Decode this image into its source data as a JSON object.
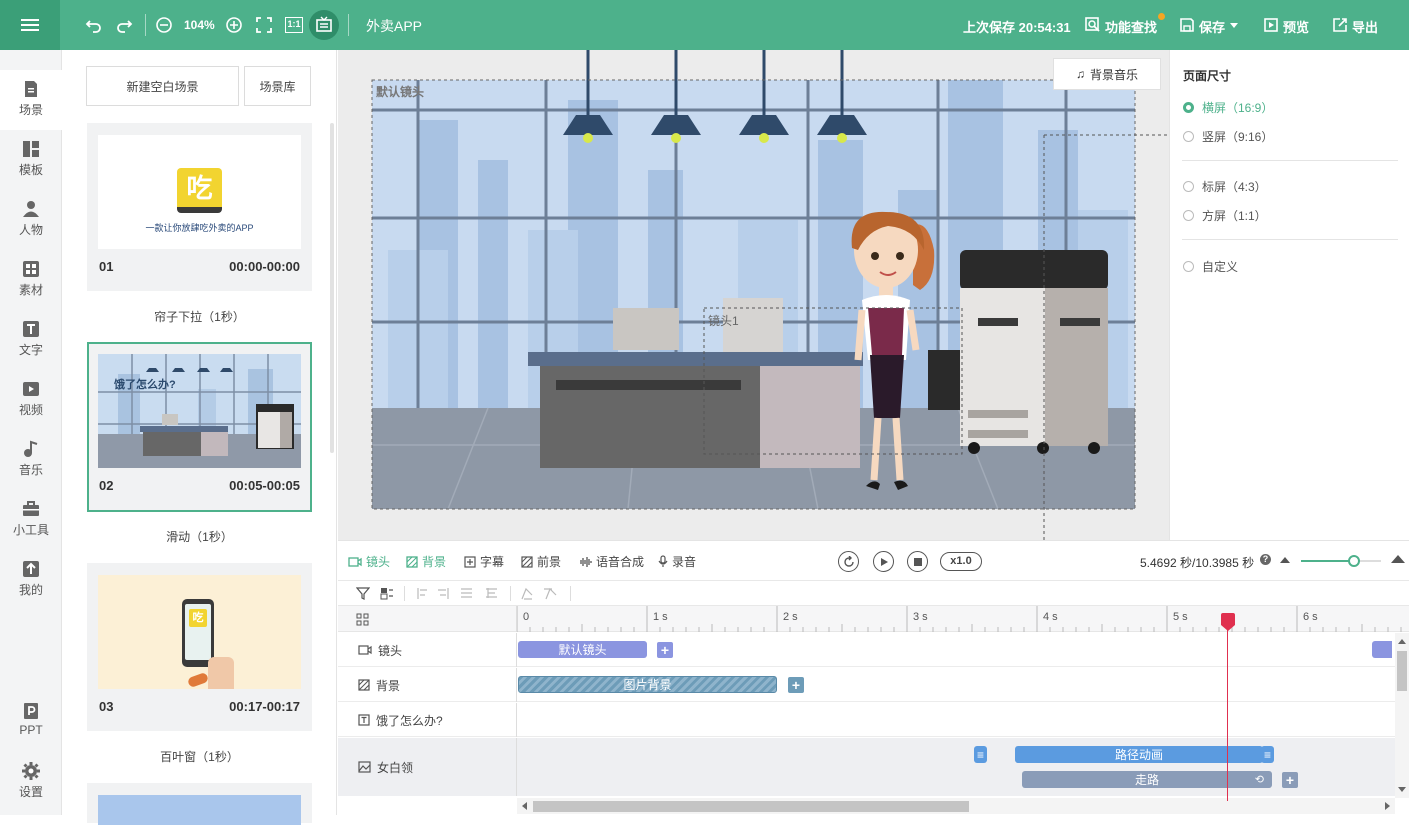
{
  "topbar": {
    "zoom": "104%",
    "app_title": "外卖APP",
    "last_saved": "上次保存 20:54:31",
    "feature_search": "功能查找",
    "save": "保存",
    "preview": "预览",
    "export": "导出",
    "ratio_icon": "1:1"
  },
  "nav": [
    {
      "label": "场景",
      "icon": "scene-icon"
    },
    {
      "label": "模板",
      "icon": "template-icon"
    },
    {
      "label": "人物",
      "icon": "person-icon"
    },
    {
      "label": "素材",
      "icon": "material-icon"
    },
    {
      "label": "文字",
      "icon": "text-icon"
    },
    {
      "label": "视频",
      "icon": "video-icon"
    },
    {
      "label": "音乐",
      "icon": "music-icon"
    },
    {
      "label": "小工具",
      "icon": "toolbox-icon"
    },
    {
      "label": "我的",
      "icon": "upload-icon"
    },
    {
      "label": "PPT",
      "icon": "ppt-icon"
    },
    {
      "label": "设置",
      "icon": "gear-icon"
    }
  ],
  "scene_panel": {
    "new_blank": "新建空白场景",
    "library": "场景库",
    "scenes": [
      {
        "num": "01",
        "time": "00:00-00:00",
        "transition": "帘子下拉（1秒）",
        "thumb_text": "一款让你放肆吃外卖的APP",
        "logo_char": "吃"
      },
      {
        "num": "02",
        "time": "00:05-00:05",
        "transition": "滑动（1秒）",
        "thumb_text": "饿了怎么办?"
      },
      {
        "num": "03",
        "time": "00:17-00:17",
        "transition": "百叶窗（1秒）",
        "logo_char": "吃"
      }
    ]
  },
  "canvas": {
    "default_camera_label": "默认镜头",
    "camera1_label": "镜头1",
    "bg_music": "背景音乐"
  },
  "page_size": {
    "title": "页面尺寸",
    "options": [
      {
        "label": "横屏（16:9）",
        "selected": true
      },
      {
        "label": "竖屏（9:16）",
        "selected": false
      },
      {
        "label": "标屏（4:3）",
        "selected": false
      },
      {
        "label": "方屏（1:1）",
        "selected": false
      },
      {
        "label": "自定义",
        "selected": false
      }
    ]
  },
  "timeline": {
    "tabs": [
      "镜头",
      "背景",
      "字幕",
      "前景",
      "语音合成",
      "录音"
    ],
    "speed": "x1.0",
    "time_display": "5.4692 秒/10.3985 秒",
    "ruler": [
      "0",
      "1 s",
      "2 s",
      "3 s",
      "4 s",
      "5 s",
      "6 s"
    ],
    "playhead_seconds": 5.4692,
    "total_seconds": 10.3985,
    "rows": [
      {
        "label": "镜头",
        "icon": "camera-icon"
      },
      {
        "label": "背景",
        "icon": "background-icon"
      },
      {
        "label": "饿了怎么办?",
        "icon": "text-box-icon"
      },
      {
        "label": "女白领",
        "icon": "image-icon"
      }
    ],
    "clips": {
      "camera": "默认镜头",
      "background": "图片背景",
      "path_anim": "路径动画",
      "walk": "走路"
    }
  },
  "colors": {
    "brand": "#4db18b",
    "playhead": "#e0304f",
    "clip_camera": "#8b95e0",
    "clip_path": "#5b9be0",
    "clip_walk": "#8a9cb8"
  }
}
